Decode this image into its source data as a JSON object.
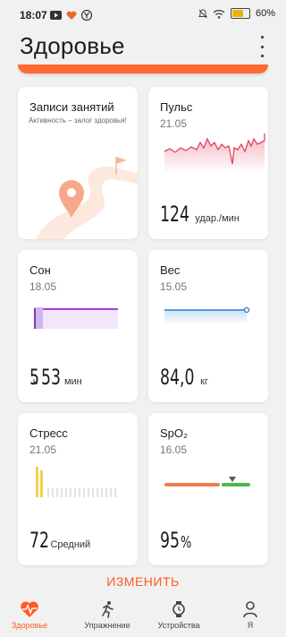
{
  "status": {
    "time": "18:07",
    "battery": "60"
  },
  "header": {
    "title": "Здоровье"
  },
  "cards": {
    "activity": {
      "title": "Записи занятий",
      "subtitle": "Активность – залог здоровья!"
    },
    "pulse": {
      "title": "Пульс",
      "date": "21.05",
      "value": "124",
      "unit": "удар./мин"
    },
    "sleep": {
      "title": "Сон",
      "date": "18.05",
      "hours": "5",
      "hours_unit": "ч",
      "minutes": "53",
      "minutes_unit": "мин"
    },
    "weight": {
      "title": "Вес",
      "date": "15.05",
      "value": "84,0",
      "unit": "кг"
    },
    "stress": {
      "title": "Стресс",
      "date": "21.05",
      "value": "72",
      "level": "Средний"
    },
    "spo2": {
      "title": "SpO₂",
      "date": "16.05",
      "value": "95",
      "unit": "%"
    }
  },
  "edit_button": "ИЗМЕНИТЬ",
  "tabs": [
    {
      "label": "Здоровье",
      "icon": "heart-pulse-icon",
      "active": true
    },
    {
      "label": "Упражнение",
      "icon": "running-icon",
      "active": false
    },
    {
      "label": "Устройства",
      "icon": "watch-icon",
      "active": false
    },
    {
      "label": "Я",
      "icon": "person-icon",
      "active": false
    }
  ],
  "colors": {
    "accent": "#ff5a1f",
    "pulse": "#e0455e",
    "sleep": "#b03ad0",
    "weight": "#2a7fd0",
    "stress": "#f2d34a",
    "spo2_low": "#f07f4a",
    "spo2_high": "#4cb84e"
  }
}
